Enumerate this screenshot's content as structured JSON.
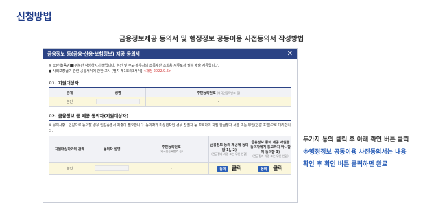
{
  "heading": "신청방법",
  "subtitle": "금융정보제공 동의서 및 행정정보 공동이용 사전동의서 작성방법",
  "dialog": {
    "title": "금융정보 등(금융·신용·보험정보) 제공 동의서",
    "close": "✕",
    "notice_1": "※ 노란색(음영■)부분만 작성하시기 바랍니다. 본인 및 부모·배우자의 소득재산 조회용 서류로서 필수 제출 서류입니다.",
    "notice_2": "● 사회보장급여 관련 공통서식에 관한 고시 [별지 제1호의3서식]",
    "notice_2_date": "<개정 2022.9.5>",
    "section1": "01. 지원대상자",
    "table1": {
      "headers": [
        "관계",
        "성명",
        "주민등록번호"
      ],
      "id_note": "(외국인등록번호 등)",
      "row": [
        "본인",
        "",
        "-"
      ]
    },
    "section2": "02. 금융정보 등 제공 동의자(지원대상자)",
    "caution": "※ 유의사항 : 인감으로 동의할 경우 인감증명서 제출이 필요합니다. 동의자가 미성년자인 경우 친권자 등 보호자의 자필 한글정자 서명 또는 무인(인감 포함)으로 대리합니다.",
    "table2": {
      "headers": [
        "지원대상자와의 관계",
        "동의자 성명",
        "주민등록번호",
        "금융정보 등의 제공에 동의함 1), 2)",
        "금융정보 등의 제공 사실을 동의자에게 통보하지 아니함에 동의함 3)"
      ],
      "id_note": "(외국인등록번호 등)",
      "sign_note": "(한글정자 서명 또는 무인·인감)",
      "row": [
        "본인",
        "",
        "-"
      ],
      "agree_btn": "동의",
      "click": "클릭"
    }
  },
  "instructions": {
    "line1": "두가지 동의 클릭 후 아래 확인 버튼 클릭",
    "line2": "※행정정보 공동이용 사전동의서는 내용",
    "line3": "확인 후 확인 버튼 클릭하면 완료"
  }
}
